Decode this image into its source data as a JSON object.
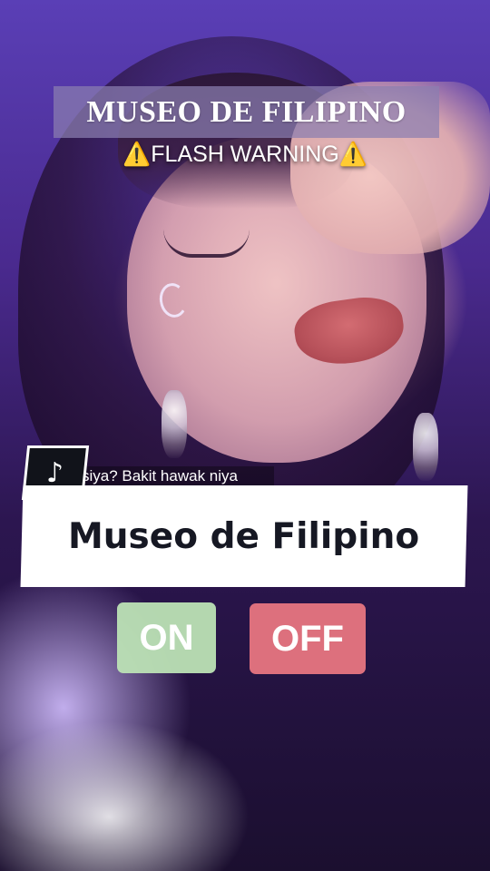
{
  "overlay": {
    "title": "MUSEO DE FILIPINO",
    "warning": "⚠️FLASH WARNING⚠️",
    "caption_snippet": "siya? Bakit hawak niya",
    "name_card": "Museo de Filipino"
  },
  "buttons": {
    "on_label": "ON",
    "off_label": "OFF",
    "on_color": "#bce2b5",
    "off_color": "#ed7882"
  },
  "badge": {
    "icon": "tiktok-logo-icon",
    "glyph": "♪"
  }
}
